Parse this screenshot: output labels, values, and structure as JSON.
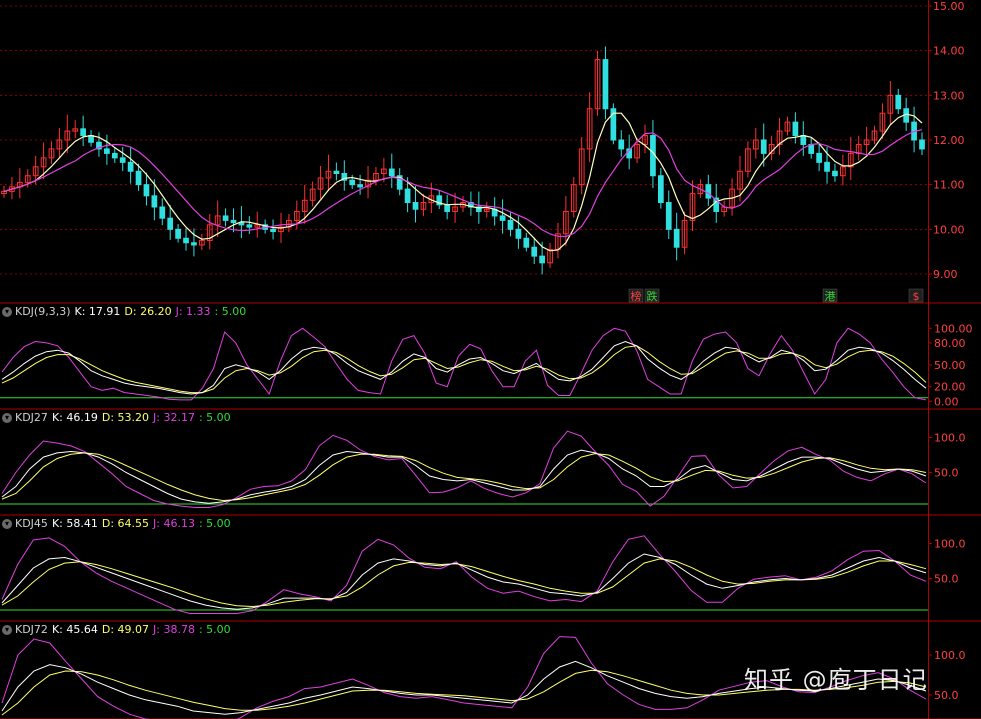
{
  "main": {
    "price_ticks": [
      "15.00",
      "14.00",
      "13.00",
      "12.00",
      "11.00",
      "10.00",
      "9.00"
    ],
    "events": [
      {
        "text": "榜",
        "color": "#ff4040"
      },
      {
        "text": "跌",
        "color": "#33dd33"
      },
      {
        "text": "港",
        "color": "#33dd33"
      },
      {
        "text": "$",
        "color": "#ff4040"
      }
    ]
  },
  "panels": [
    {
      "name": "KDJ(9,3,3)",
      "k": "K: 17.91",
      "d": "D: 26.20",
      "j": "J: 1.33",
      "ref": ": 5.00",
      "ticks": [
        "100.00",
        "80.00",
        "50.00",
        "20.00",
        "0.00"
      ]
    },
    {
      "name": "KDJ27",
      "k": "K: 46.19",
      "d": "D: 53.20",
      "j": "J: 32.17",
      "ref": ": 5.00",
      "ticks": [
        "100.0",
        "50.0"
      ]
    },
    {
      "name": "KDJ45",
      "k": "K: 58.41",
      "d": "D: 64.55",
      "j": "J: 46.13",
      "ref": ": 5.00",
      "ticks": [
        "100.0",
        "50.0"
      ]
    },
    {
      "name": "KDJ72",
      "k": "K: 45.64",
      "d": "D: 49.07",
      "j": "J: 38.78",
      "ref": ": 5.00",
      "ticks": [
        "100.0",
        "50.0"
      ]
    }
  ],
  "watermark": "知乎 @庖丁日记",
  "colors": {
    "background": "#000000",
    "grid_red": "#b00000",
    "rise": "#ff3030",
    "fall": "#30e0e0",
    "ma_short": "#ffffc0",
    "ma_long": "#e040e0",
    "k_line": "#ffffff",
    "d_line": "#ffff66",
    "j_line": "#e040e0",
    "ref_line": "#33dd33"
  },
  "chart_data": {
    "type": "candlestick",
    "price_ylim": [
      8.6,
      15.1
    ],
    "price_close": [
      10.85,
      10.95,
      11.05,
      11.2,
      11.4,
      11.6,
      11.8,
      12.0,
      12.2,
      12.25,
      12.1,
      11.95,
      11.8,
      11.7,
      11.6,
      11.5,
      11.3,
      11.0,
      10.75,
      10.5,
      10.25,
      10.0,
      9.8,
      9.7,
      9.65,
      9.75,
      10.1,
      10.3,
      10.2,
      10.15,
      10.1,
      10.05,
      10.1,
      10.0,
      9.95,
      10.05,
      10.2,
      10.4,
      10.65,
      10.9,
      11.15,
      11.3,
      11.25,
      11.1,
      11.0,
      10.95,
      11.1,
      11.25,
      11.35,
      11.2,
      10.9,
      10.6,
      10.45,
      10.6,
      10.75,
      10.55,
      10.4,
      10.5,
      10.6,
      10.5,
      10.4,
      10.45,
      10.3,
      10.2,
      10.0,
      9.8,
      9.6,
      9.4,
      9.25,
      9.55,
      9.9,
      10.4,
      11.0,
      11.8,
      12.7,
      13.8,
      12.7,
      12.0,
      11.8,
      11.6,
      11.9,
      12.1,
      11.2,
      10.6,
      10.0,
      9.6,
      10.2,
      10.8,
      11.0,
      10.7,
      10.4,
      10.5,
      10.9,
      11.3,
      11.8,
      12.0,
      11.7,
      11.9,
      12.2,
      12.4,
      12.1,
      11.9,
      11.7,
      11.5,
      11.3,
      11.2,
      11.4,
      11.7,
      11.9,
      12.0,
      12.2,
      12.6,
      13.0,
      12.7,
      12.4,
      12.0,
      11.8
    ],
    "kdj": [
      {
        "name": "KDJ(9,3,3)",
        "ylim": [
          -5,
          110
        ],
        "ref": 5,
        "k": [
          30,
          40,
          52,
          62,
          68,
          70,
          66,
          55,
          42,
          35,
          30,
          25,
          22,
          20,
          18,
          15,
          12,
          10,
          12,
          22,
          45,
          50,
          46,
          40,
          30,
          42,
          58,
          70,
          74,
          72,
          64,
          52,
          42,
          36,
          30,
          40,
          55,
          65,
          60,
          45,
          40,
          50,
          58,
          60,
          52,
          42,
          38,
          45,
          52,
          40,
          30,
          28,
          34,
          44,
          60,
          76,
          82,
          76,
          58,
          46,
          36,
          30,
          40,
          55,
          66,
          74,
          72,
          62,
          54,
          60,
          70,
          66,
          56,
          42,
          44,
          56,
          70,
          74,
          72,
          66,
          56,
          44,
          30,
          18
        ],
        "d": [
          25,
          32,
          42,
          52,
          60,
          64,
          64,
          58,
          50,
          42,
          36,
          30,
          26,
          23,
          20,
          17,
          14,
          12,
          12,
          17,
          32,
          42,
          45,
          42,
          36,
          39,
          48,
          60,
          68,
          70,
          67,
          59,
          49,
          41,
          35,
          37,
          46,
          57,
          59,
          52,
          45,
          47,
          53,
          57,
          55,
          48,
          42,
          43,
          48,
          44,
          36,
          31,
          32,
          39,
          50,
          64,
          74,
          76,
          67,
          55,
          45,
          37,
          38,
          47,
          57,
          66,
          69,
          66,
          59,
          59,
          65,
          66,
          61,
          50,
          46,
          51,
          61,
          68,
          70,
          68,
          62,
          52,
          40,
          26
        ],
        "j": [
          40,
          60,
          75,
          82,
          80,
          76,
          60,
          40,
          20,
          15,
          18,
          12,
          10,
          8,
          6,
          3,
          2,
          2,
          18,
          45,
          95,
          80,
          50,
          30,
          10,
          55,
          90,
          100,
          88,
          75,
          52,
          30,
          15,
          12,
          10,
          55,
          85,
          90,
          65,
          25,
          20,
          62,
          78,
          72,
          42,
          20,
          20,
          55,
          70,
          22,
          8,
          8,
          38,
          70,
          90,
          100,
          96,
          70,
          30,
          20,
          10,
          10,
          55,
          85,
          92,
          95,
          80,
          45,
          35,
          65,
          90,
          70,
          40,
          10,
          30,
          80,
          100,
          92,
          80,
          58,
          40,
          20,
          5,
          2
        ]
      },
      {
        "name": "KDJ27",
        "ylim": [
          -5,
          115
        ],
        "ref": 5,
        "k": [
          15,
          30,
          55,
          72,
          78,
          80,
          78,
          72,
          62,
          50,
          40,
          30,
          20,
          12,
          8,
          6,
          8,
          12,
          18,
          22,
          25,
          30,
          40,
          60,
          75,
          80,
          78,
          75,
          72,
          72,
          60,
          45,
          40,
          38,
          40,
          35,
          30,
          25,
          25,
          30,
          55,
          75,
          82,
          78,
          70,
          55,
          45,
          30,
          30,
          40,
          55,
          60,
          50,
          40,
          38,
          45,
          55,
          65,
          72,
          72,
          70,
          62,
          55,
          50,
          52,
          55,
          52,
          45
        ],
        "d": [
          12,
          20,
          38,
          58,
          70,
          76,
          78,
          76,
          69,
          60,
          51,
          42,
          33,
          25,
          18,
          13,
          10,
          11,
          14,
          18,
          22,
          26,
          33,
          46,
          61,
          72,
          76,
          76,
          74,
          73,
          67,
          57,
          49,
          43,
          41,
          39,
          35,
          30,
          27,
          28,
          40,
          58,
          72,
          77,
          75,
          66,
          56,
          44,
          37,
          38,
          46,
          53,
          52,
          46,
          42,
          43,
          49,
          57,
          65,
          70,
          71,
          67,
          61,
          56,
          54,
          55,
          54,
          50
        ],
        "j": [
          20,
          50,
          75,
          95,
          92,
          88,
          80,
          64,
          48,
          30,
          20,
          10,
          5,
          2,
          0,
          0,
          4,
          14,
          26,
          30,
          31,
          38,
          54,
          88,
          103,
          96,
          82,
          73,
          68,
          70,
          46,
          21,
          22,
          28,
          38,
          27,
          20,
          15,
          21,
          34,
          85,
          109,
          102,
          80,
          60,
          33,
          23,
          2,
          16,
          44,
          73,
          74,
          46,
          28,
          30,
          49,
          67,
          81,
          86,
          76,
          68,
          52,
          43,
          38,
          48,
          55,
          48,
          35
        ]
      },
      {
        "name": "KDJ45",
        "ylim": [
          -5,
          115
        ],
        "ref": 5,
        "k": [
          15,
          40,
          65,
          78,
          80,
          74,
          66,
          58,
          50,
          42,
          34,
          26,
          18,
          12,
          8,
          6,
          8,
          14,
          22,
          22,
          22,
          20,
          30,
          55,
          72,
          78,
          75,
          70,
          68,
          72,
          62,
          52,
          45,
          42,
          36,
          30,
          28,
          25,
          30,
          50,
          72,
          85,
          80,
          70,
          55,
          42,
          36,
          40,
          45,
          48,
          50,
          48,
          50,
          55,
          65,
          75,
          80,
          75,
          65,
          58
        ],
        "d": [
          12,
          25,
          45,
          63,
          72,
          74,
          70,
          64,
          57,
          50,
          43,
          36,
          28,
          21,
          15,
          11,
          10,
          12,
          16,
          19,
          21,
          21,
          25,
          38,
          55,
          68,
          73,
          72,
          70,
          71,
          67,
          60,
          53,
          47,
          42,
          36,
          32,
          29,
          29,
          38,
          55,
          72,
          78,
          75,
          66,
          55,
          46,
          42,
          43,
          46,
          48,
          48,
          49,
          52,
          59,
          68,
          75,
          75,
          70,
          64
        ],
        "j": [
          20,
          70,
          105,
          108,
          96,
          74,
          58,
          46,
          36,
          26,
          16,
          6,
          0,
          0,
          0,
          0,
          4,
          18,
          34,
          28,
          24,
          18,
          40,
          89,
          106,
          98,
          79,
          66,
          64,
          74,
          52,
          36,
          29,
          32,
          24,
          18,
          20,
          17,
          32,
          74,
          106,
          111,
          84,
          60,
          33,
          16,
          16,
          36,
          49,
          52,
          54,
          48,
          52,
          61,
          77,
          89,
          90,
          75,
          55,
          46
        ]
      },
      {
        "name": "KDJ72",
        "ylim": [
          20,
          120
        ],
        "ref": 5,
        "k": [
          30,
          60,
          80,
          88,
          84,
          76,
          66,
          58,
          50,
          44,
          40,
          36,
          30,
          28,
          26,
          28,
          32,
          36,
          40,
          46,
          50,
          55,
          60,
          58,
          55,
          52,
          50,
          50,
          48,
          46,
          44,
          42,
          40,
          50,
          70,
          85,
          92,
          84,
          74,
          66,
          58,
          52,
          48,
          46,
          48,
          52,
          55,
          58,
          60,
          58,
          56,
          55,
          58,
          62,
          66,
          70,
          68,
          62,
          55
        ],
        "d": [
          25,
          40,
          60,
          75,
          80,
          79,
          75,
          69,
          62,
          56,
          51,
          46,
          41,
          37,
          33,
          31,
          31,
          33,
          36,
          40,
          45,
          50,
          55,
          56,
          56,
          54,
          52,
          51,
          50,
          49,
          47,
          45,
          43,
          45,
          54,
          66,
          77,
          81,
          79,
          74,
          68,
          62,
          56,
          52,
          50,
          50,
          52,
          54,
          56,
          57,
          57,
          56,
          57,
          59,
          62,
          66,
          67,
          65,
          60
        ],
        "j": [
          40,
          100,
          120,
          115,
          92,
          70,
          48,
          36,
          26,
          20,
          18,
          16,
          8,
          10,
          12,
          22,
          34,
          42,
          48,
          58,
          60,
          65,
          70,
          62,
          53,
          48,
          46,
          48,
          44,
          40,
          38,
          36,
          34,
          60,
          102,
          123,
          122,
          90,
          64,
          50,
          38,
          32,
          32,
          34,
          44,
          56,
          61,
          66,
          68,
          60,
          54,
          53,
          60,
          68,
          74,
          78,
          70,
          56,
          45
        ]
      }
    ]
  }
}
